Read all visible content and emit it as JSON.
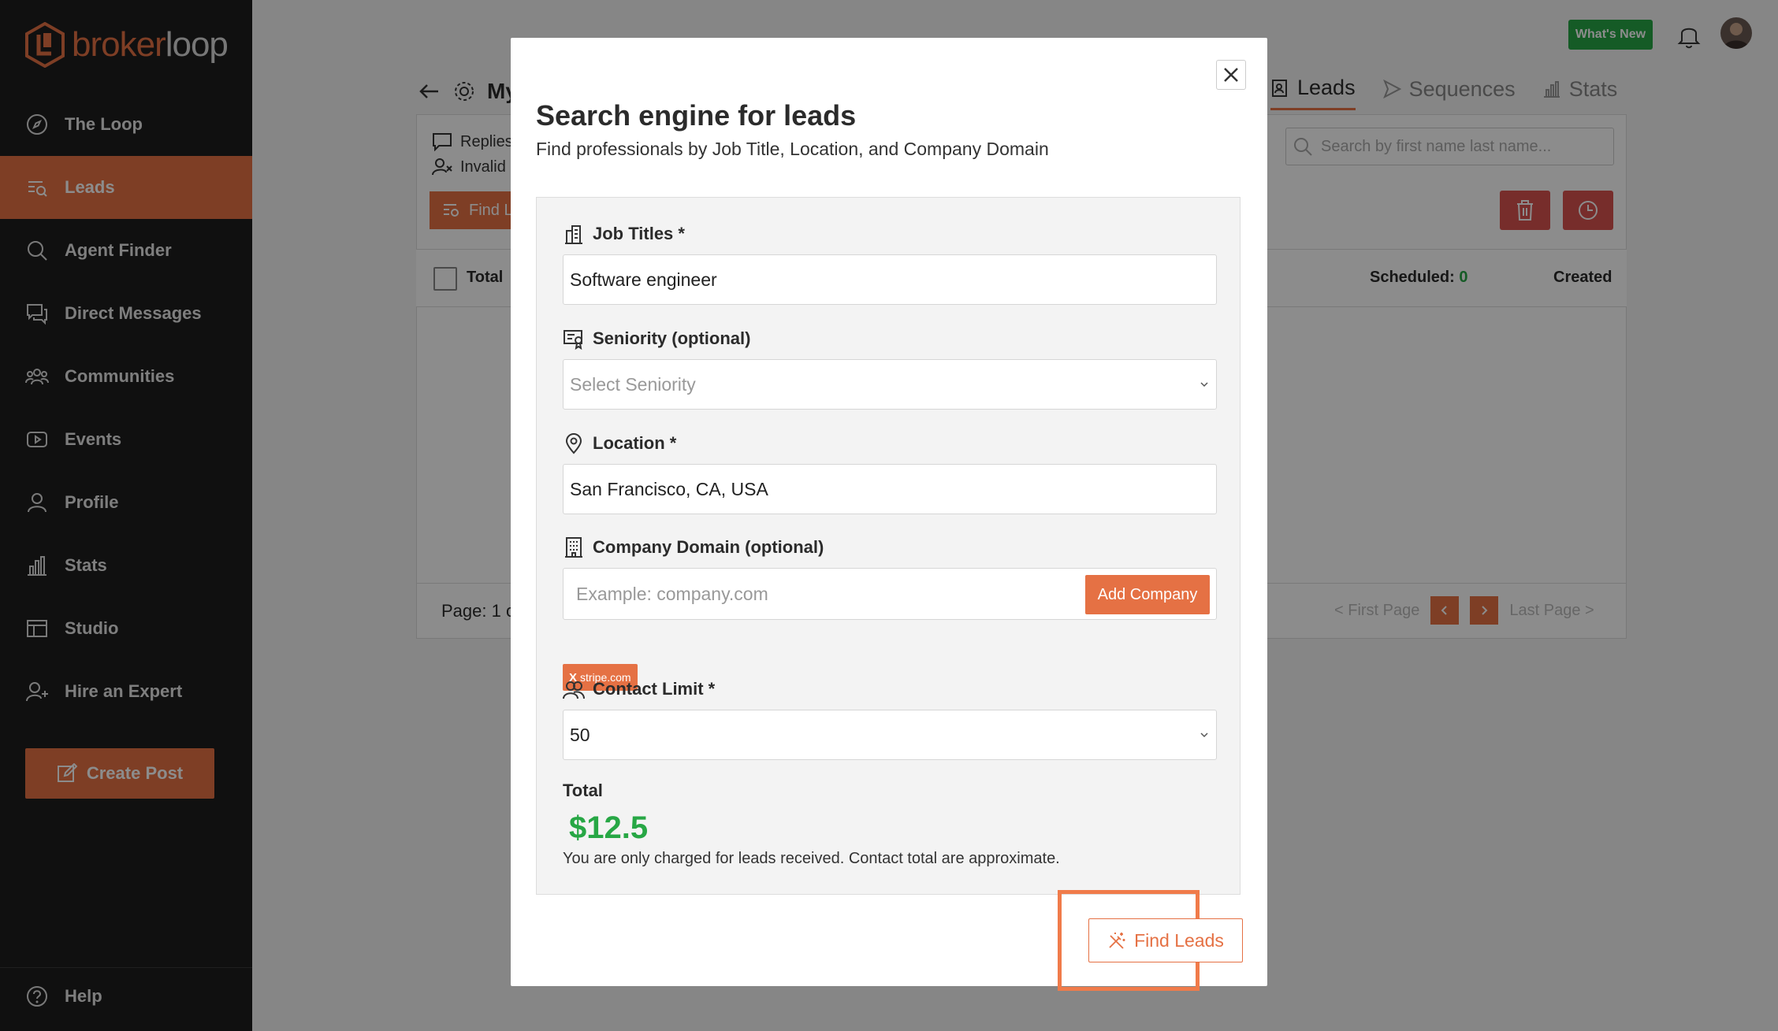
{
  "brand": {
    "name_part1": "broker",
    "name_part2": "loop"
  },
  "sidebar": {
    "items": [
      {
        "label": "The Loop",
        "icon": "compass-icon"
      },
      {
        "label": "Leads",
        "icon": "list-search-icon",
        "active": true
      },
      {
        "label": "Agent Finder",
        "icon": "search-icon"
      },
      {
        "label": "Direct Messages",
        "icon": "chat-icon"
      },
      {
        "label": "Communities",
        "icon": "group-icon"
      },
      {
        "label": "Events",
        "icon": "play-icon"
      },
      {
        "label": "Profile",
        "icon": "user-icon"
      },
      {
        "label": "Stats",
        "icon": "bar-chart-icon"
      },
      {
        "label": "Studio",
        "icon": "layout-icon"
      },
      {
        "label": "Hire an Expert",
        "icon": "user-plus-icon"
      }
    ],
    "create_post": "Create Post",
    "help": "Help"
  },
  "topbar": {
    "whats_new": "What's New"
  },
  "background": {
    "title": "My",
    "tabs": [
      "Leads",
      "Sequences",
      "Stats"
    ],
    "replies": "Replies",
    "invalid": "Invalid",
    "find_btn": "Find L",
    "search_placeholder": "Search by first name last name...",
    "total": "Total",
    "scheduled_label": "Scheduled:",
    "scheduled_value": "0",
    "created": "Created",
    "page": "Page: 1 o",
    "first_page": "< First Page",
    "last_page": "Last Page >"
  },
  "modal": {
    "title": "Search engine for leads",
    "subtitle": "Find professionals by Job Title, Location, and Company Domain",
    "job_titles_label": "Job Titles *",
    "job_titles_value": "Software engineer",
    "seniority_label": "Seniority (optional)",
    "seniority_placeholder": "Select Seniority",
    "location_label": "Location *",
    "location_value": "San Francisco, CA, USA",
    "company_label": "Company Domain (optional)",
    "company_placeholder": "Example: company.com",
    "add_company": "Add Company",
    "chip_x": "X",
    "chip_value": "stripe.com",
    "contact_limit_label": "Contact Limit *",
    "contact_limit_value": "50",
    "total_label": "Total",
    "total_value": "$12.5",
    "total_note": "You are only charged for leads received. Contact total are approximate.",
    "find_leads": "Find Leads"
  },
  "colors": {
    "accent": "#e57144",
    "success": "#27a745",
    "sidebar": "#1e1e1e",
    "danger": "#d9534f"
  }
}
